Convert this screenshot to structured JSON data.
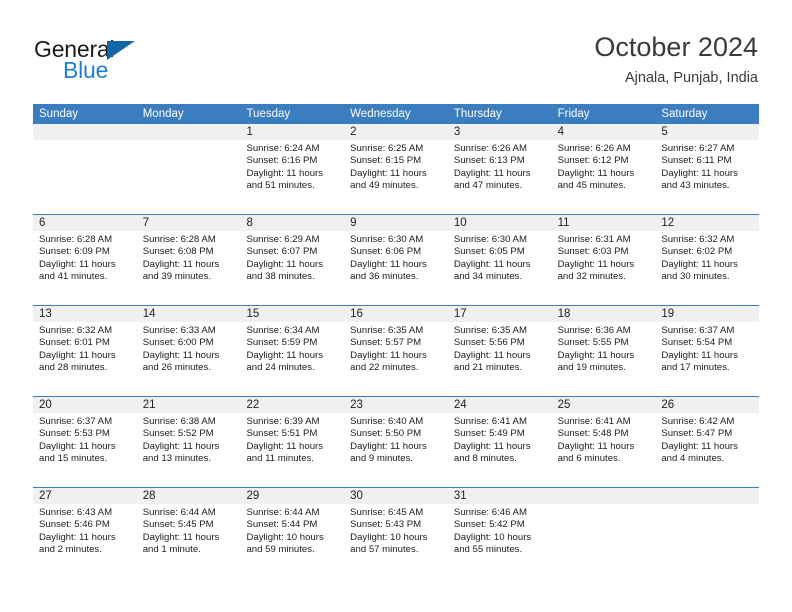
{
  "logo": {
    "word_one": "General",
    "word_two": "Blue",
    "triangle_color": "#1464aa",
    "blue_color": "#1e7fd4"
  },
  "header": {
    "title": "October 2024",
    "subtitle": "Ajnala, Punjab, India"
  },
  "theme": {
    "header_blue": "#3b7dbf",
    "daynum_band": "#f0f0f0",
    "text": "#1c1c1c"
  },
  "weekdays": [
    "Sunday",
    "Monday",
    "Tuesday",
    "Wednesday",
    "Thursday",
    "Friday",
    "Saturday"
  ],
  "weeks": [
    [
      {
        "day": "",
        "empty": true,
        "sunrise": "",
        "sunset": "",
        "daylight_1": "",
        "daylight_2": ""
      },
      {
        "day": "",
        "empty": true,
        "sunrise": "",
        "sunset": "",
        "daylight_1": "",
        "daylight_2": ""
      },
      {
        "day": "1",
        "sunrise": "Sunrise: 6:24 AM",
        "sunset": "Sunset: 6:16 PM",
        "daylight_1": "Daylight: 11 hours",
        "daylight_2": "and 51 minutes."
      },
      {
        "day": "2",
        "sunrise": "Sunrise: 6:25 AM",
        "sunset": "Sunset: 6:15 PM",
        "daylight_1": "Daylight: 11 hours",
        "daylight_2": "and 49 minutes."
      },
      {
        "day": "3",
        "sunrise": "Sunrise: 6:26 AM",
        "sunset": "Sunset: 6:13 PM",
        "daylight_1": "Daylight: 11 hours",
        "daylight_2": "and 47 minutes."
      },
      {
        "day": "4",
        "sunrise": "Sunrise: 6:26 AM",
        "sunset": "Sunset: 6:12 PM",
        "daylight_1": "Daylight: 11 hours",
        "daylight_2": "and 45 minutes."
      },
      {
        "day": "5",
        "sunrise": "Sunrise: 6:27 AM",
        "sunset": "Sunset: 6:11 PM",
        "daylight_1": "Daylight: 11 hours",
        "daylight_2": "and 43 minutes."
      }
    ],
    [
      {
        "day": "6",
        "sunrise": "Sunrise: 6:28 AM",
        "sunset": "Sunset: 6:09 PM",
        "daylight_1": "Daylight: 11 hours",
        "daylight_2": "and 41 minutes."
      },
      {
        "day": "7",
        "sunrise": "Sunrise: 6:28 AM",
        "sunset": "Sunset: 6:08 PM",
        "daylight_1": "Daylight: 11 hours",
        "daylight_2": "and 39 minutes."
      },
      {
        "day": "8",
        "sunrise": "Sunrise: 6:29 AM",
        "sunset": "Sunset: 6:07 PM",
        "daylight_1": "Daylight: 11 hours",
        "daylight_2": "and 38 minutes."
      },
      {
        "day": "9",
        "sunrise": "Sunrise: 6:30 AM",
        "sunset": "Sunset: 6:06 PM",
        "daylight_1": "Daylight: 11 hours",
        "daylight_2": "and 36 minutes."
      },
      {
        "day": "10",
        "sunrise": "Sunrise: 6:30 AM",
        "sunset": "Sunset: 6:05 PM",
        "daylight_1": "Daylight: 11 hours",
        "daylight_2": "and 34 minutes."
      },
      {
        "day": "11",
        "sunrise": "Sunrise: 6:31 AM",
        "sunset": "Sunset: 6:03 PM",
        "daylight_1": "Daylight: 11 hours",
        "daylight_2": "and 32 minutes."
      },
      {
        "day": "12",
        "sunrise": "Sunrise: 6:32 AM",
        "sunset": "Sunset: 6:02 PM",
        "daylight_1": "Daylight: 11 hours",
        "daylight_2": "and 30 minutes."
      }
    ],
    [
      {
        "day": "13",
        "sunrise": "Sunrise: 6:32 AM",
        "sunset": "Sunset: 6:01 PM",
        "daylight_1": "Daylight: 11 hours",
        "daylight_2": "and 28 minutes."
      },
      {
        "day": "14",
        "sunrise": "Sunrise: 6:33 AM",
        "sunset": "Sunset: 6:00 PM",
        "daylight_1": "Daylight: 11 hours",
        "daylight_2": "and 26 minutes."
      },
      {
        "day": "15",
        "sunrise": "Sunrise: 6:34 AM",
        "sunset": "Sunset: 5:59 PM",
        "daylight_1": "Daylight: 11 hours",
        "daylight_2": "and 24 minutes."
      },
      {
        "day": "16",
        "sunrise": "Sunrise: 6:35 AM",
        "sunset": "Sunset: 5:57 PM",
        "daylight_1": "Daylight: 11 hours",
        "daylight_2": "and 22 minutes."
      },
      {
        "day": "17",
        "sunrise": "Sunrise: 6:35 AM",
        "sunset": "Sunset: 5:56 PM",
        "daylight_1": "Daylight: 11 hours",
        "daylight_2": "and 21 minutes."
      },
      {
        "day": "18",
        "sunrise": "Sunrise: 6:36 AM",
        "sunset": "Sunset: 5:55 PM",
        "daylight_1": "Daylight: 11 hours",
        "daylight_2": "and 19 minutes."
      },
      {
        "day": "19",
        "sunrise": "Sunrise: 6:37 AM",
        "sunset": "Sunset: 5:54 PM",
        "daylight_1": "Daylight: 11 hours",
        "daylight_2": "and 17 minutes."
      }
    ],
    [
      {
        "day": "20",
        "sunrise": "Sunrise: 6:37 AM",
        "sunset": "Sunset: 5:53 PM",
        "daylight_1": "Daylight: 11 hours",
        "daylight_2": "and 15 minutes."
      },
      {
        "day": "21",
        "sunrise": "Sunrise: 6:38 AM",
        "sunset": "Sunset: 5:52 PM",
        "daylight_1": "Daylight: 11 hours",
        "daylight_2": "and 13 minutes."
      },
      {
        "day": "22",
        "sunrise": "Sunrise: 6:39 AM",
        "sunset": "Sunset: 5:51 PM",
        "daylight_1": "Daylight: 11 hours",
        "daylight_2": "and 11 minutes."
      },
      {
        "day": "23",
        "sunrise": "Sunrise: 6:40 AM",
        "sunset": "Sunset: 5:50 PM",
        "daylight_1": "Daylight: 11 hours",
        "daylight_2": "and 9 minutes."
      },
      {
        "day": "24",
        "sunrise": "Sunrise: 6:41 AM",
        "sunset": "Sunset: 5:49 PM",
        "daylight_1": "Daylight: 11 hours",
        "daylight_2": "and 8 minutes."
      },
      {
        "day": "25",
        "sunrise": "Sunrise: 6:41 AM",
        "sunset": "Sunset: 5:48 PM",
        "daylight_1": "Daylight: 11 hours",
        "daylight_2": "and 6 minutes."
      },
      {
        "day": "26",
        "sunrise": "Sunrise: 6:42 AM",
        "sunset": "Sunset: 5:47 PM",
        "daylight_1": "Daylight: 11 hours",
        "daylight_2": "and 4 minutes."
      }
    ],
    [
      {
        "day": "27",
        "sunrise": "Sunrise: 6:43 AM",
        "sunset": "Sunset: 5:46 PM",
        "daylight_1": "Daylight: 11 hours",
        "daylight_2": "and 2 minutes."
      },
      {
        "day": "28",
        "sunrise": "Sunrise: 6:44 AM",
        "sunset": "Sunset: 5:45 PM",
        "daylight_1": "Daylight: 11 hours",
        "daylight_2": "and 1 minute."
      },
      {
        "day": "29",
        "sunrise": "Sunrise: 6:44 AM",
        "sunset": "Sunset: 5:44 PM",
        "daylight_1": "Daylight: 10 hours",
        "daylight_2": "and 59 minutes."
      },
      {
        "day": "30",
        "sunrise": "Sunrise: 6:45 AM",
        "sunset": "Sunset: 5:43 PM",
        "daylight_1": "Daylight: 10 hours",
        "daylight_2": "and 57 minutes."
      },
      {
        "day": "31",
        "sunrise": "Sunrise: 6:46 AM",
        "sunset": "Sunset: 5:42 PM",
        "daylight_1": "Daylight: 10 hours",
        "daylight_2": "and 55 minutes."
      },
      {
        "day": "",
        "empty": true,
        "sunrise": "",
        "sunset": "",
        "daylight_1": "",
        "daylight_2": ""
      },
      {
        "day": "",
        "empty": true,
        "sunrise": "",
        "sunset": "",
        "daylight_1": "",
        "daylight_2": ""
      }
    ]
  ]
}
